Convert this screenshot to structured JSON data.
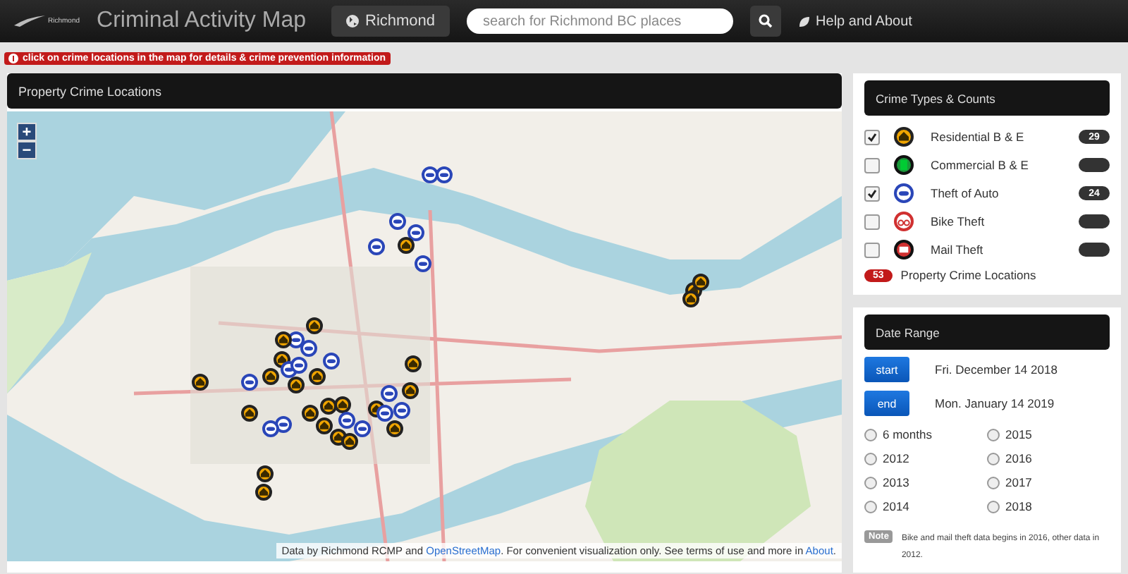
{
  "navbar": {
    "brand_logo": "Richmond",
    "title": "Criminal Activity Map",
    "location_button": "Richmond",
    "search": {
      "placeholder": "search for Richmond BC places"
    },
    "help_link": "Help and About"
  },
  "notice": "click on crime locations in the map for details & crime prevention information",
  "map_panel": {
    "title": "Property Crime Locations",
    "zoom_in": "+",
    "zoom_out": "−",
    "attribution": [
      {
        "text": "Data by Richmond RCMP and ",
        "kind": "text"
      },
      {
        "text": "OpenStreetMap",
        "kind": "link"
      },
      {
        "text": ". For convenient visualization only. See terms of use and more in ",
        "kind": "text"
      },
      {
        "text": "About",
        "kind": "link"
      },
      {
        "text": ".",
        "kind": "text"
      }
    ]
  },
  "crime_types": {
    "title": "Crime Types & Counts",
    "items": [
      {
        "label": "Residential B & E",
        "kind": "residential",
        "checked": true,
        "count": "29"
      },
      {
        "label": "Commercial B & E",
        "kind": "commercial",
        "checked": false
      },
      {
        "label": "Theft of Auto",
        "kind": "auto",
        "checked": true,
        "count": "24"
      },
      {
        "label": "Bike Theft",
        "kind": "bike",
        "checked": false
      },
      {
        "label": "Mail Theft",
        "kind": "mail",
        "checked": false
      }
    ],
    "total": "53",
    "total_label": "Property Crime Locations"
  },
  "date_range": {
    "title": "Date Range",
    "start_button": "start",
    "start_date": "Fri. December 14 2018",
    "end_button": "end",
    "end_date": "Mon. January 14 2019",
    "options": [
      {
        "label": "6 months",
        "selected": false
      },
      {
        "label": "2015",
        "selected": false
      },
      {
        "label": "2012",
        "selected": false
      },
      {
        "label": "2016",
        "selected": false
      },
      {
        "label": "2013",
        "selected": false
      },
      {
        "label": "2017",
        "selected": false
      },
      {
        "label": "2014",
        "selected": false
      },
      {
        "label": "2018",
        "selected": false
      }
    ],
    "note_label": "Note",
    "note": "Bike and mail theft data begins in 2016, other data in 2012."
  }
}
